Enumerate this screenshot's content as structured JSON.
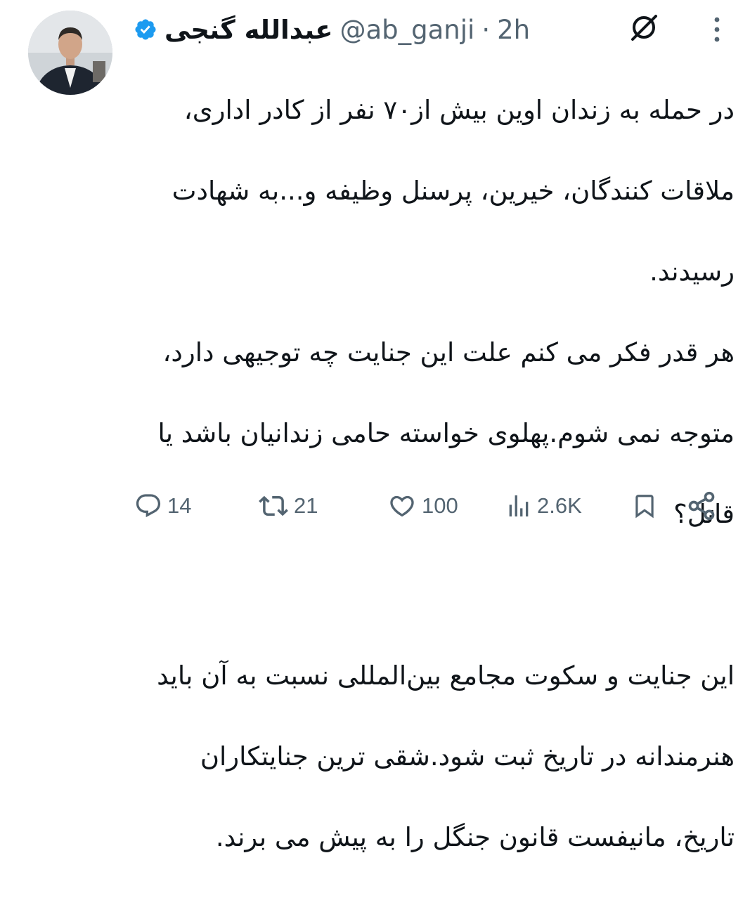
{
  "tweet": {
    "author": {
      "display_name": "عبدالله گنجی",
      "handle": "@ab_ganji",
      "separator": "·",
      "time": "2h"
    },
    "body": [
      "در حمله به زندان اوین بیش از۷۰ نفر از کادر اداری،",
      "ملاقات کنندگان، خیرین، پرسنل وظیفه و...به شهادت",
      "رسیدند.",
      "هر قدر فکر می کنم علت این جنایت چه توجیهی دارد،",
      "متوجه نمی شوم.پهلوی خواسته حامی زندانیان باشد یا",
      "قاتل؟",
      "",
      "این جنایت و سکوت مجامع بین‌المللی نسبت به آن باید",
      "هنرمندانه در تاریخ ثبت شود.شقی ترین جنایتکاران",
      "تاریخ، مانیفست قانون جنگل را به پیش می برند."
    ],
    "actions": {
      "replies": "14",
      "reposts": "21",
      "likes": "100",
      "views": "2.6K"
    }
  },
  "colors": {
    "text": "#0f1419",
    "secondary": "#536471",
    "verified": "#1d9bf0"
  },
  "icons": {
    "verified": "verified-badge-icon",
    "grok": "grok-icon",
    "more": "more-vertical-icon",
    "reply": "reply-icon",
    "repost": "repost-icon",
    "like": "heart-icon",
    "views": "views-icon",
    "bookmark": "bookmark-icon",
    "share": "share-icon"
  }
}
